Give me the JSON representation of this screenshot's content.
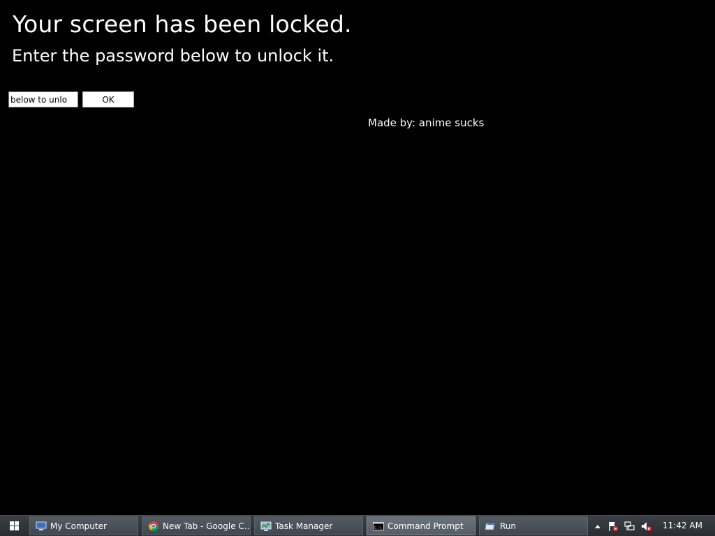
{
  "lock_screen": {
    "title": "Your screen has been locked.",
    "subtitle": "Enter the password below to unlock it.",
    "password_value": "below to unlo",
    "ok_label": "OK",
    "credit": "Made by: anime sucks"
  },
  "taskbar": {
    "items": [
      {
        "label": "My Computer",
        "icon": "computer-icon",
        "active": false
      },
      {
        "label": "New Tab - Google C...",
        "icon": "chrome-icon",
        "active": false
      },
      {
        "label": "Task Manager",
        "icon": "task-manager-icon",
        "active": false
      },
      {
        "label": "Command Prompt",
        "icon": "command-prompt-icon",
        "active": true
      },
      {
        "label": "Run",
        "icon": "run-icon",
        "active": false
      }
    ],
    "tray_icons": [
      "show-hidden-icons-arrow",
      "action-center-flag-icon",
      "network-icon",
      "volume-muted-icon"
    ],
    "clock": "11:42 AM"
  },
  "colors": {
    "background": "#000000",
    "text": "#ffffff",
    "taskbar": "#2f343a"
  }
}
